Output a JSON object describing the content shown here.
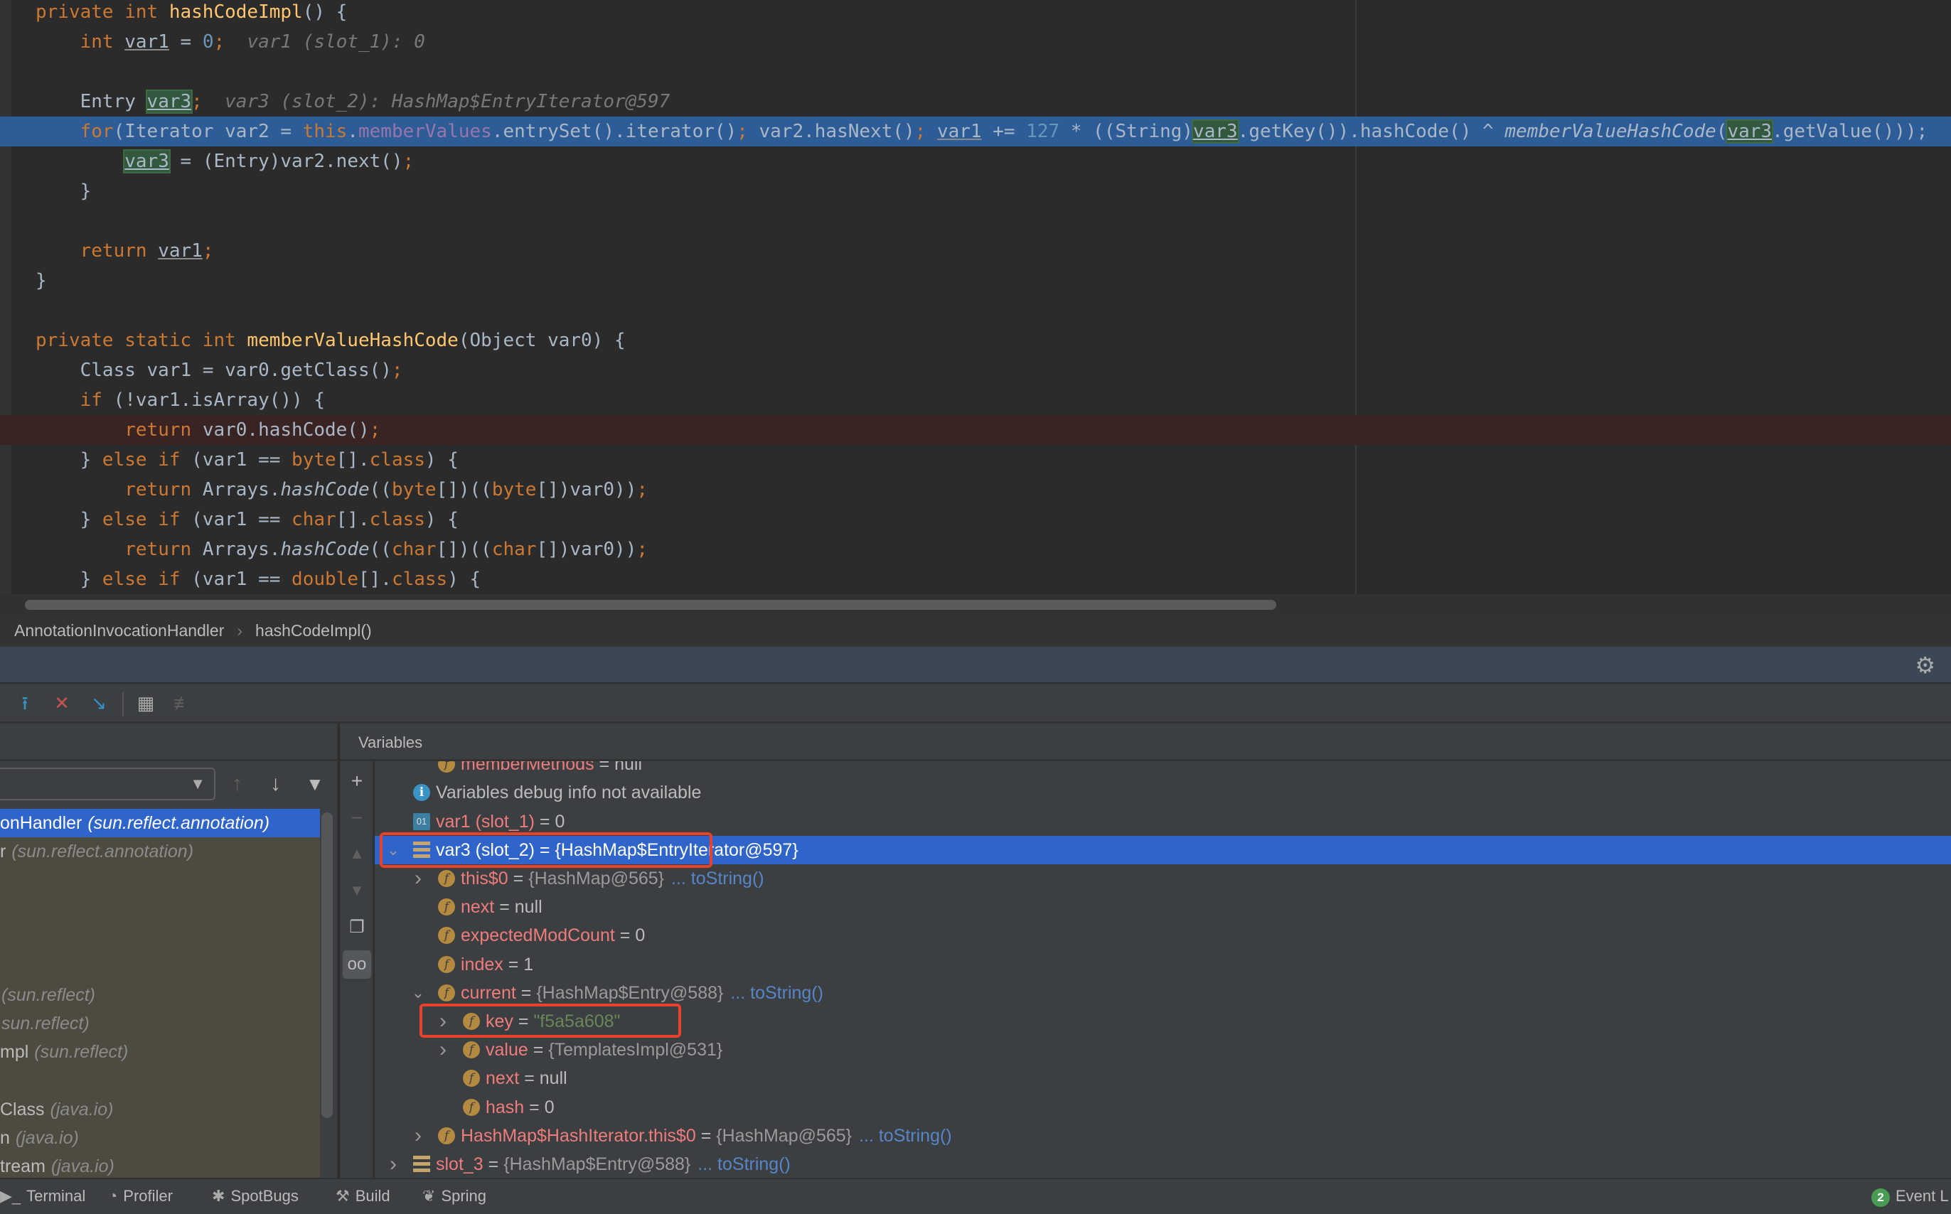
{
  "editor": {
    "lines": [
      {
        "state": "",
        "tokens": [
          [
            "k",
            "private int "
          ],
          [
            "m",
            "hashCodeImpl"
          ],
          [
            "t",
            "() {"
          ]
        ]
      },
      {
        "state": "",
        "tokens": [
          [
            "t",
            "    "
          ],
          [
            "k",
            "int "
          ],
          [
            "u",
            "var1"
          ],
          [
            "t",
            " = "
          ],
          [
            "n",
            "0"
          ],
          [
            "k",
            ";"
          ],
          [
            "h",
            "  var1 (slot_1): 0"
          ]
        ]
      },
      {
        "state": "",
        "tokens": []
      },
      {
        "state": "",
        "tokens": [
          [
            "t",
            "    Entry "
          ],
          [
            "g",
            "var3"
          ],
          [
            "k",
            ";"
          ],
          [
            "h",
            "  var3 (slot_2): HashMap$EntryIterator@597"
          ]
        ]
      },
      {
        "state": "exec",
        "tokens": [
          [
            "t",
            "    "
          ],
          [
            "k",
            "for"
          ],
          [
            "t",
            "(Iterator var2 = "
          ],
          [
            "k",
            "this"
          ],
          [
            "t",
            "."
          ],
          [
            "f",
            "memberValues"
          ],
          [
            "t",
            ".entrySet().iterator()"
          ],
          [
            "k",
            ";"
          ],
          [
            "t",
            " var2.hasNext()"
          ],
          [
            "k",
            ";"
          ],
          [
            "t",
            " "
          ],
          [
            "u",
            "var1"
          ],
          [
            "t",
            " += "
          ],
          [
            "n",
            "127"
          ],
          [
            "t",
            " * ((String)"
          ],
          [
            "g",
            "var3"
          ],
          [
            "t",
            ".getKey()).hashCode() ^ "
          ],
          [
            "i",
            "memberValueHashCode"
          ],
          [
            "t",
            "("
          ],
          [
            "g",
            "var3"
          ],
          [
            "t",
            ".getValue()));"
          ]
        ]
      },
      {
        "state": "",
        "tokens": [
          [
            "t",
            "        "
          ],
          [
            "g",
            "var3"
          ],
          [
            "t",
            " = (Entry)var2.next()"
          ],
          [
            "k",
            ";"
          ]
        ]
      },
      {
        "state": "",
        "tokens": [
          [
            "t",
            "    }"
          ]
        ]
      },
      {
        "state": "",
        "tokens": []
      },
      {
        "state": "",
        "tokens": [
          [
            "t",
            "    "
          ],
          [
            "k",
            "return "
          ],
          [
            "u",
            "var1"
          ],
          [
            "k",
            ";"
          ]
        ]
      },
      {
        "state": "",
        "tokens": [
          [
            "t",
            "}"
          ]
        ]
      },
      {
        "state": "",
        "tokens": []
      },
      {
        "state": "",
        "tokens": [
          [
            "k",
            "private static int "
          ],
          [
            "m",
            "memberValueHashCode"
          ],
          [
            "t",
            "(Object var0) {"
          ]
        ]
      },
      {
        "state": "",
        "tokens": [
          [
            "t",
            "    Class var1 = var0.getClass()"
          ],
          [
            "k",
            ";"
          ]
        ]
      },
      {
        "state": "",
        "tokens": [
          [
            "t",
            "    "
          ],
          [
            "k",
            "if "
          ],
          [
            "t",
            "(!var1.isArray()) {"
          ]
        ]
      },
      {
        "state": "bp",
        "tokens": [
          [
            "t",
            "        "
          ],
          [
            "k",
            "return "
          ],
          [
            "t",
            "var0.hashCode()"
          ],
          [
            "k",
            ";"
          ]
        ]
      },
      {
        "state": "",
        "tokens": [
          [
            "t",
            "    } "
          ],
          [
            "k",
            "else if "
          ],
          [
            "t",
            "(var1 == "
          ],
          [
            "k",
            "byte"
          ],
          [
            "t",
            "[]."
          ],
          [
            "k",
            "class"
          ],
          [
            "t",
            ") {"
          ]
        ]
      },
      {
        "state": "",
        "tokens": [
          [
            "t",
            "        "
          ],
          [
            "k",
            "return "
          ],
          [
            "t",
            "Arrays."
          ],
          [
            "i",
            "hashCode"
          ],
          [
            "t",
            "(("
          ],
          [
            "k",
            "byte"
          ],
          [
            "t",
            "[])(("
          ],
          [
            "k",
            "byte"
          ],
          [
            "t",
            "[])var0))"
          ],
          [
            "k",
            ";"
          ]
        ]
      },
      {
        "state": "",
        "tokens": [
          [
            "t",
            "    } "
          ],
          [
            "k",
            "else if "
          ],
          [
            "t",
            "(var1 == "
          ],
          [
            "k",
            "char"
          ],
          [
            "t",
            "[]."
          ],
          [
            "k",
            "class"
          ],
          [
            "t",
            ") {"
          ]
        ]
      },
      {
        "state": "",
        "tokens": [
          [
            "t",
            "        "
          ],
          [
            "k",
            "return "
          ],
          [
            "t",
            "Arrays."
          ],
          [
            "i",
            "hashCode"
          ],
          [
            "t",
            "(("
          ],
          [
            "k",
            "char"
          ],
          [
            "t",
            "[])(("
          ],
          [
            "k",
            "char"
          ],
          [
            "t",
            "[])var0))"
          ],
          [
            "k",
            ";"
          ]
        ]
      },
      {
        "state": "",
        "tokens": [
          [
            "t",
            "    } "
          ],
          [
            "k",
            "else if "
          ],
          [
            "t",
            "(var1 == "
          ],
          [
            "k",
            "double"
          ],
          [
            "t",
            "[]."
          ],
          [
            "k",
            "class"
          ],
          [
            "t",
            ") {"
          ]
        ]
      }
    ]
  },
  "breadcrumb": {
    "class_name": "AnnotationInvocationHandler",
    "separator": "›",
    "method": "hashCodeImpl()"
  },
  "debugger": {
    "variables_title": "Variables",
    "frames": [
      {
        "name": "onHandler",
        "pkg": "(sun.reflect.annotation)",
        "selected": true
      },
      {
        "name": "r",
        "pkg": "(sun.reflect.annotation)"
      },
      {
        "name": "",
        "pkg": ""
      },
      {
        "name": "",
        "pkg": ""
      },
      {
        "name": "",
        "pkg": ""
      },
      {
        "name": "",
        "pkg": ""
      },
      {
        "name": "",
        "pkg": "(sun.reflect)"
      },
      {
        "name": "",
        "pkg": "sun.reflect)"
      },
      {
        "name": "mpl",
        "pkg": "(sun.reflect)"
      },
      {
        "name": "",
        "pkg": ""
      },
      {
        "name": "Class",
        "pkg": "(java.io)"
      },
      {
        "name": "n",
        "pkg": "(java.io)"
      },
      {
        "name": "tream",
        "pkg": "(java.io)"
      }
    ],
    "variables": [
      {
        "level": 1,
        "exp": "none",
        "icon": "field",
        "name": "memberMethods",
        "value": "null",
        "kind": "plain"
      },
      {
        "level": 0,
        "exp": "none",
        "icon": "info",
        "info": "Variables debug info not available"
      },
      {
        "level": 0,
        "exp": "none",
        "icon": "prim",
        "name": "var1 (slot_1)",
        "value": "0",
        "kind": "plain"
      },
      {
        "level": 0,
        "exp": "expanded",
        "icon": "local",
        "name": "var3 (slot_2)",
        "value": "{HashMap$EntryIterator@597}",
        "kind": "obj",
        "selected": true
      },
      {
        "level": 1,
        "exp": "collapsed",
        "icon": "field",
        "name": "this$0",
        "value": "{HashMap@565}",
        "kind": "obj",
        "link": "... toString()"
      },
      {
        "level": 1,
        "exp": "none",
        "icon": "field",
        "name": "next",
        "value": "null",
        "kind": "plain"
      },
      {
        "level": 1,
        "exp": "none",
        "icon": "field",
        "name": "expectedModCount",
        "value": "0",
        "kind": "plain"
      },
      {
        "level": 1,
        "exp": "none",
        "icon": "field",
        "name": "index",
        "value": "1",
        "kind": "plain"
      },
      {
        "level": 1,
        "exp": "expanded",
        "icon": "field",
        "name": "current",
        "value": "{HashMap$Entry@588}",
        "kind": "obj",
        "link": "... toString()"
      },
      {
        "level": 2,
        "exp": "collapsed",
        "icon": "field",
        "name": "key",
        "value": "\"f5a5a608\"",
        "kind": "str"
      },
      {
        "level": 2,
        "exp": "collapsed",
        "icon": "field",
        "name": "value",
        "value": "{TemplatesImpl@531}",
        "kind": "obj"
      },
      {
        "level": 2,
        "exp": "none",
        "icon": "field",
        "name": "next",
        "value": "null",
        "kind": "plain"
      },
      {
        "level": 2,
        "exp": "none",
        "icon": "field",
        "name": "hash",
        "value": "0",
        "kind": "plain"
      },
      {
        "level": 1,
        "exp": "collapsed",
        "icon": "field",
        "name": "HashMap$HashIterator.this$0",
        "value": "{HashMap@565}",
        "kind": "obj",
        "link": "... toString()"
      },
      {
        "level": 0,
        "exp": "collapsed",
        "icon": "local",
        "name": "slot_3",
        "value": "{HashMap$Entry@588}",
        "kind": "obj",
        "link": "... toString()"
      }
    ]
  },
  "status_bar": {
    "terminal": "Terminal",
    "profiler": "Profiler",
    "spotbugs": "SpotBugs",
    "build": "Build",
    "spring": "Spring",
    "event_log": "Event L",
    "event_count": "2"
  },
  "colors": {
    "selection": "#2f65ca",
    "exec_line": "#2d5c97",
    "highlight_box": "#e8412c",
    "library_frames": "#4d4a40"
  }
}
